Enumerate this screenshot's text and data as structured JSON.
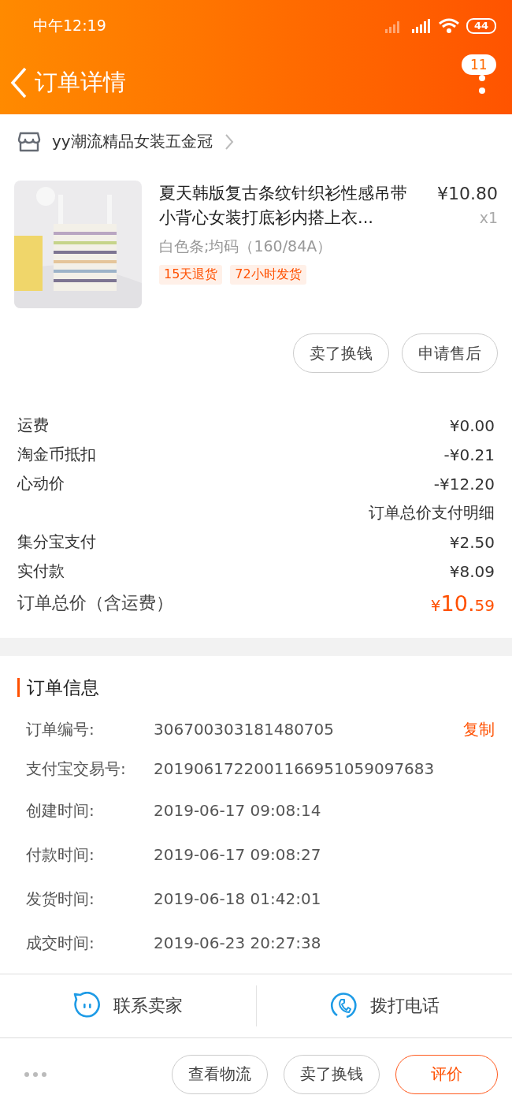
{
  "status_bar": {
    "time": "中午12:19",
    "battery": "44"
  },
  "nav": {
    "title": "订单详情",
    "badge": "11"
  },
  "shop": {
    "name": "yy潮流精品女装五金冠"
  },
  "product": {
    "title": "夏天韩版复古条纹针织衫性感吊带小背心女装打底衫内搭上衣...",
    "price": "¥10.80",
    "quantity": "x1",
    "sku": "白色条;均码（160/84A）",
    "tags": [
      "15天退货",
      "72小时发货"
    ]
  },
  "item_actions": [
    "卖了换钱",
    "申请售后"
  ],
  "fees": [
    {
      "kind": "row",
      "label": "运费",
      "value": "¥0.00"
    },
    {
      "kind": "row",
      "label": "淘金币抵扣",
      "value": "-¥0.21"
    },
    {
      "kind": "row",
      "label": "心动价",
      "value": "-¥12.20"
    },
    {
      "kind": "note",
      "value": "订单总价支付明细"
    },
    {
      "kind": "row",
      "label": "集分宝支付",
      "value": "¥2.50"
    },
    {
      "kind": "row",
      "label": "实付款",
      "value": "¥8.09"
    }
  ],
  "total": {
    "label": "订单总价（含运费）",
    "symbol": "¥",
    "integer": "10.",
    "fraction": "59"
  },
  "order_info": {
    "title": "订单信息",
    "rows": [
      {
        "label": "订单编号:",
        "value": "306700303181480705",
        "action": "复制"
      },
      {
        "label": "支付宝交易号:",
        "value": "2019061722001166951059097683"
      },
      {
        "label": "创建时间:",
        "value": "2019-06-17 09:08:14"
      },
      {
        "label": "付款时间:",
        "value": "2019-06-17 09:08:27"
      },
      {
        "label": "发货时间:",
        "value": "2019-06-18 01:42:01"
      },
      {
        "label": "成交时间:",
        "value": "2019-06-23 20:27:38"
      }
    ]
  },
  "contact": [
    {
      "kind": "chat",
      "label": "联系卖家"
    },
    {
      "kind": "phone",
      "label": "拨打电话"
    }
  ],
  "bottom_actions": [
    {
      "label": "查看物流",
      "primary": false
    },
    {
      "label": "卖了换钱",
      "primary": false
    },
    {
      "label": "评价",
      "primary": true
    }
  ]
}
